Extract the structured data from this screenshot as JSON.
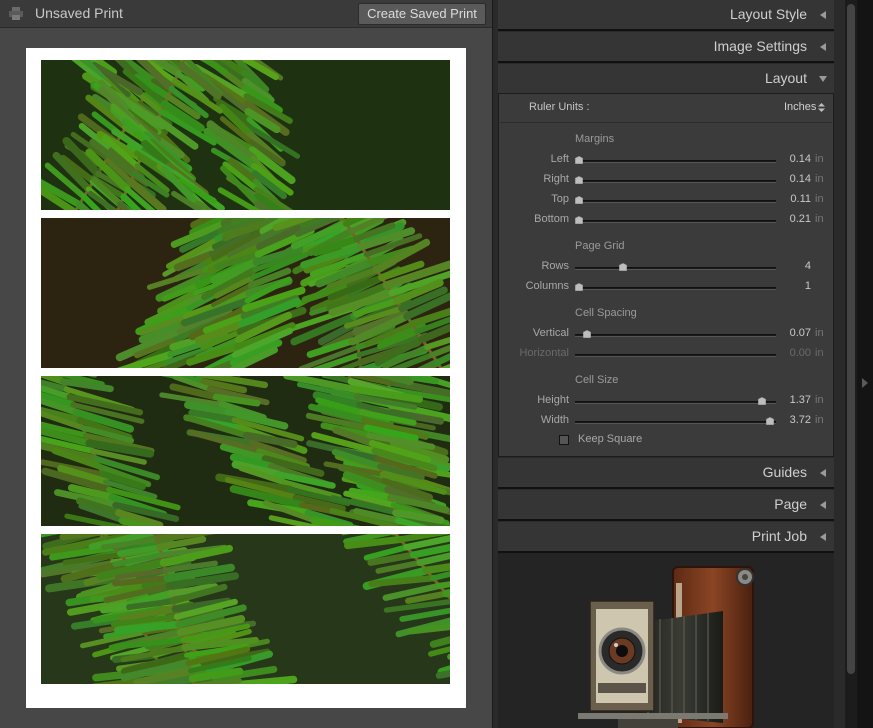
{
  "left_panel": {
    "title": "Unsaved Print",
    "create_saved_print_label": "Create Saved Print",
    "print_cells": 4
  },
  "right_panel": {
    "headers": {
      "layout_style": "Layout Style",
      "image_settings": "Image Settings",
      "layout": "Layout",
      "guides": "Guides",
      "page": "Page",
      "print_job": "Print Job"
    },
    "layout": {
      "ruler_units_label": "Ruler Units :",
      "ruler_units_value": "Inches",
      "margins_title": "Margins",
      "margins": [
        {
          "label": "Left",
          "value": "0.14",
          "unit": "in",
          "level": 0.0
        },
        {
          "label": "Right",
          "value": "0.14",
          "unit": "in",
          "level": 0.0
        },
        {
          "label": "Top",
          "value": "0.11",
          "unit": "in",
          "level": 0.0
        },
        {
          "label": "Bottom",
          "value": "0.21",
          "unit": "in",
          "level": 0.0
        }
      ],
      "page_grid_title": "Page Grid",
      "page_grid": [
        {
          "label": "Rows",
          "value": "4",
          "level": 0.23
        },
        {
          "label": "Columns",
          "value": "1",
          "level": 0.0
        }
      ],
      "cell_spacing_title": "Cell Spacing",
      "cell_spacing": [
        {
          "label": "Vertical",
          "value": "0.07",
          "unit": "in",
          "level": 0.04
        },
        {
          "label": "Horizontal",
          "value": "0.00",
          "unit": "in",
          "level": null,
          "disabled": true
        }
      ],
      "cell_size_title": "Cell Size",
      "cell_size": [
        {
          "label": "Height",
          "value": "1.37",
          "unit": "in",
          "level": 0.95
        },
        {
          "label": "Width",
          "value": "3.72",
          "unit": "in",
          "level": 0.99
        }
      ],
      "keep_square_label": "Keep Square",
      "keep_square_checked": false
    }
  },
  "icons": {
    "print": "printer-icon",
    "collapsed": "triangle-left-icon",
    "expanded": "triangle-down-icon",
    "stepper": "up-down-arrows-icon",
    "side_toggle": "triangle-right-icon"
  },
  "colors": {
    "panel_bg": "#2a2a2a",
    "header_bg": "#353535",
    "layout_bg": "#3b3b3b",
    "preview_bg": "#474747",
    "fern_green": "#4a8a28"
  }
}
